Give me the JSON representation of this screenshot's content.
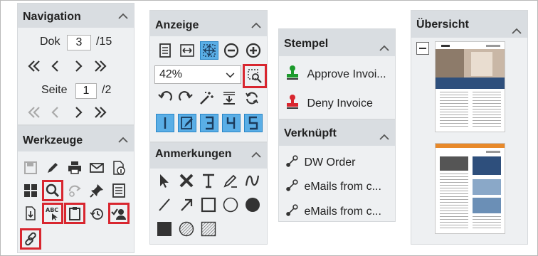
{
  "navigation": {
    "title": "Navigation",
    "doc_label": "Dok",
    "doc_value": "3",
    "doc_total": "/15",
    "page_label": "Seite",
    "page_value": "1",
    "page_total": "/2"
  },
  "werkzeuge": {
    "title": "Werkzeuge"
  },
  "anzeige": {
    "title": "Anzeige",
    "zoom_value": "42%"
  },
  "anmerkungen": {
    "title": "Anmerkungen"
  },
  "stempel": {
    "title": "Stempel",
    "items": [
      {
        "label": "Approve Invoi...",
        "color": "#1c9a2c"
      },
      {
        "label": "Deny Invoice",
        "color": "#d8262f"
      }
    ]
  },
  "verknuepft": {
    "title": "Verknüpft",
    "items": [
      {
        "label": "DW Order"
      },
      {
        "label": "eMails from c..."
      },
      {
        "label": "eMails from c..."
      }
    ]
  },
  "uebersicht": {
    "title": "Übersicht"
  },
  "colors": {
    "highlight": "#d8262f",
    "active_blue": "#5aaee6",
    "header": "#d9dde1"
  }
}
